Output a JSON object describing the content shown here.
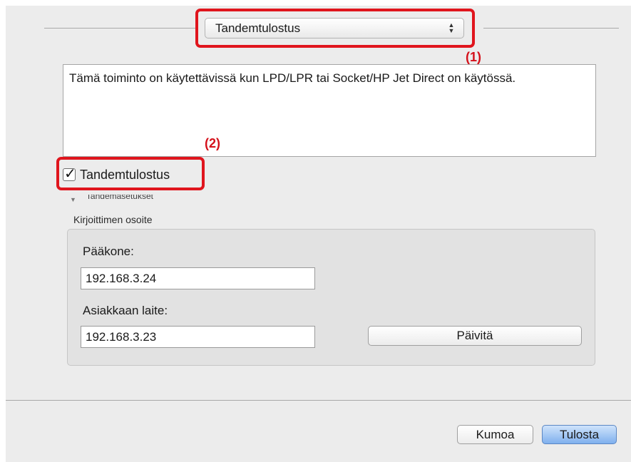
{
  "popup": {
    "value": "Tandemtulostus"
  },
  "callouts": {
    "one": "(1)",
    "two": "(2)"
  },
  "description": "Tämä toiminto on käytettävissä kun LPD/LPR tai Socket/HP Jet Direct on käytössä.",
  "checkbox": {
    "label": "Tandemtulostus",
    "checked": true
  },
  "disclosure": {
    "label": "Tandemasetukset"
  },
  "printer_address": {
    "group_label": "Kirjoittimen osoite",
    "main_label": "Pääkone:",
    "main_value": "192.168.3.24",
    "client_label": "Asiakkaan laite:",
    "client_value": "192.168.3.23",
    "refresh_button": "Päivitä"
  },
  "footer": {
    "cancel_button": "Kumoa",
    "print_button": "Tulosta"
  },
  "colors": {
    "highlight": "#e0151d",
    "callout_text": "#d4101a",
    "default_button": "#7fb0ee"
  }
}
